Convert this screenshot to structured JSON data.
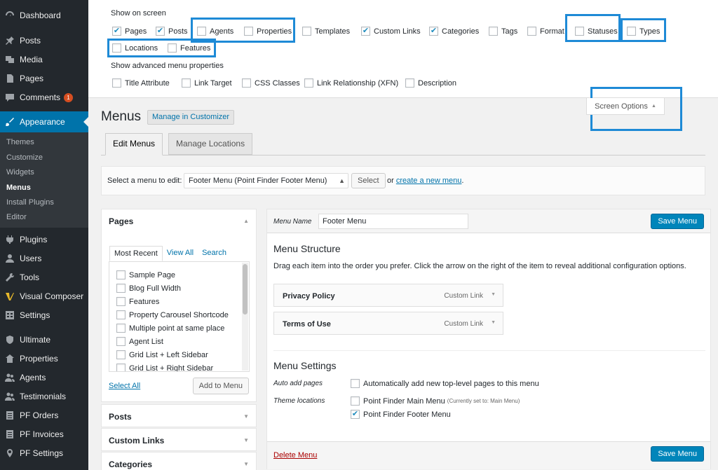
{
  "sidebar": {
    "items": [
      {
        "label": "Dashboard",
        "icon": "dashboard-icon"
      },
      {
        "label": "Posts",
        "icon": "pin-icon"
      },
      {
        "label": "Media",
        "icon": "media-icon"
      },
      {
        "label": "Pages",
        "icon": "page-icon"
      },
      {
        "label": "Comments",
        "icon": "comment-icon",
        "badge": "1"
      },
      {
        "label": "Appearance",
        "icon": "brush-icon"
      },
      {
        "label": "Plugins",
        "icon": "plugin-icon"
      },
      {
        "label": "Users",
        "icon": "users-icon"
      },
      {
        "label": "Tools",
        "icon": "wrench-icon"
      },
      {
        "label": "Visual Composer",
        "icon": "composer-icon"
      },
      {
        "label": "Settings",
        "icon": "settings-icon"
      },
      {
        "label": "Ultimate",
        "icon": "shield-icon"
      },
      {
        "label": "Properties",
        "icon": "properties-icon"
      },
      {
        "label": "Agents",
        "icon": "agents-icon"
      },
      {
        "label": "Testimonials",
        "icon": "testimonials-icon"
      },
      {
        "label": "PF Orders",
        "icon": "list-icon"
      },
      {
        "label": "PF Invoices",
        "icon": "list-icon"
      },
      {
        "label": "PF Settings",
        "icon": "location-icon"
      }
    ],
    "submenu": [
      "Themes",
      "Customize",
      "Widgets",
      "Menus",
      "Install Plugins",
      "Editor"
    ]
  },
  "screen_options": {
    "show_on_screen_heading": "Show on screen",
    "boxes": [
      {
        "label": "Pages",
        "checked": true
      },
      {
        "label": "Posts",
        "checked": true
      },
      {
        "label": "Agents",
        "checked": false
      },
      {
        "label": "Properties",
        "checked": false
      },
      {
        "label": "Templates",
        "checked": false
      },
      {
        "label": "Custom Links",
        "checked": true
      },
      {
        "label": "Categories",
        "checked": true
      },
      {
        "label": "Tags",
        "checked": false
      },
      {
        "label": "Format",
        "checked": false
      },
      {
        "label": "Statuses",
        "checked": false
      },
      {
        "label": "Types",
        "checked": false
      },
      {
        "label": "Locations",
        "checked": false
      },
      {
        "label": "Features",
        "checked": false
      }
    ],
    "advanced_heading": "Show advanced menu properties",
    "advanced": [
      {
        "label": "Title Attribute",
        "checked": false
      },
      {
        "label": "Link Target",
        "checked": false
      },
      {
        "label": "CSS Classes",
        "checked": false
      },
      {
        "label": "Link Relationship (XFN)",
        "checked": false
      },
      {
        "label": "Description",
        "checked": false
      }
    ],
    "tab_label": "Screen Options"
  },
  "page": {
    "title": "Menus",
    "manage_customizer": "Manage in Customizer",
    "tabs": [
      "Edit Menus",
      "Manage Locations"
    ],
    "select_label": "Select a menu to edit:",
    "selected_menu": "Footer Menu (Point Finder Footer Menu)",
    "select_button": "Select",
    "or_text": "or",
    "create_link": "create a new menu",
    "period": "."
  },
  "left_panels": {
    "pages": {
      "title": "Pages",
      "tabs": [
        "Most Recent",
        "View All",
        "Search"
      ],
      "items": [
        "Sample Page",
        "Blog Full Width",
        "Features",
        "Property Carousel Shortcode",
        "Multiple point at same place",
        "Agent List",
        "Grid List + Left Sidebar",
        "Grid List + Right Sidebar"
      ],
      "select_all": "Select All",
      "add_button": "Add to Menu"
    },
    "collapsed": [
      "Posts",
      "Custom Links",
      "Categories"
    ]
  },
  "editor": {
    "menu_name_label": "Menu Name",
    "menu_name_value": "Footer Menu",
    "save_label": "Save Menu",
    "structure_title": "Menu Structure",
    "structure_desc": "Drag each item into the order you prefer. Click the arrow on the right of the item to reveal additional configuration options.",
    "items": [
      {
        "title": "Privacy Policy",
        "type": "Custom Link"
      },
      {
        "title": "Terms of Use",
        "type": "Custom Link"
      }
    ],
    "settings_title": "Menu Settings",
    "auto_add_label": "Auto add pages",
    "auto_add_text": "Automatically add new top-level pages to this menu",
    "theme_locations_label": "Theme locations",
    "locations": [
      {
        "label": "Point Finder Main Menu",
        "note": "(Currently set to: Main Menu)",
        "checked": false
      },
      {
        "label": "Point Finder Footer Menu",
        "note": "",
        "checked": true
      }
    ],
    "delete_label": "Delete Menu"
  },
  "colors": {
    "accent": "#0073aa",
    "highlight": "#1e8ad6",
    "sidebar": "#23282d",
    "button": "#0085ba"
  }
}
